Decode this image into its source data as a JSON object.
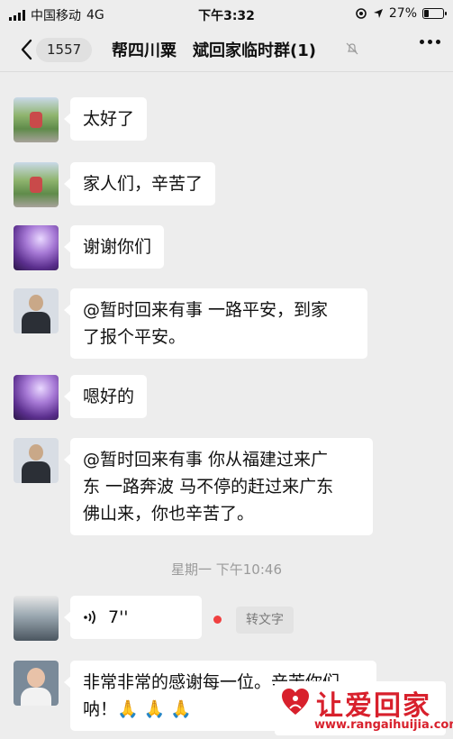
{
  "status_bar": {
    "carrier": "中国移动",
    "network": "4G",
    "time": "下午3:32",
    "battery": "27%",
    "battery_level": 0.27
  },
  "nav": {
    "back_count": "1557",
    "title": "帮四川粟　斌回家临时群(1)"
  },
  "messages": [
    {
      "text": "太好了",
      "avatar": "bike-photo"
    },
    {
      "text": "家人们，辛苦了",
      "avatar": "bike-photo"
    },
    {
      "text": "谢谢你们",
      "avatar": "purple-flower"
    },
    {
      "line1": "@暂时回来有事 一路平安，到家",
      "line2": "了报个平安。",
      "avatar": "man-suit"
    },
    {
      "text": "嗯好的",
      "avatar": "purple-flower"
    },
    {
      "line1": "@暂时回来有事 你从福建过来广",
      "line2": "东 一路奔波 马不停的赶过来广东",
      "line3": "佛山来，你也辛苦了。",
      "avatar": "man-suit"
    }
  ],
  "timestamp": "星期一 下午10:46",
  "voice": {
    "duration": "7''",
    "transcribe_label": "转文字"
  },
  "last_message": {
    "line1": "非常非常的感谢每一位。辛苦你们",
    "line2": "呐！🙏 🙏 🙏"
  },
  "watermark": {
    "title": "让爱回家",
    "url": "www.rangaihuijia.com"
  },
  "colors": {
    "background": "#ededed",
    "bubble": "#ffffff",
    "unread_dot": "#f04040",
    "watermark_red": "#d8202c"
  }
}
